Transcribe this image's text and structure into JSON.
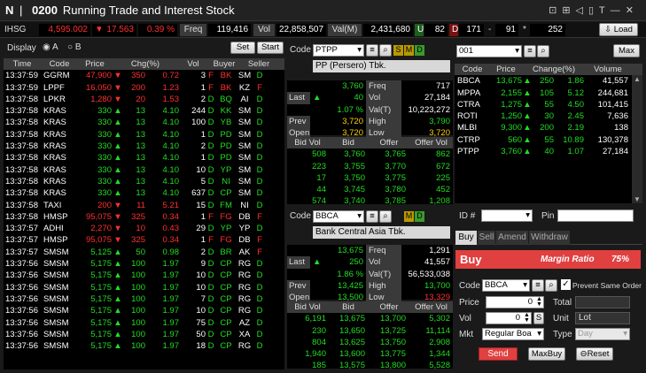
{
  "window": {
    "logo": "N",
    "title_code": "0200",
    "title": "Running Trade and Interest Stock",
    "icons": "⊡⊞◁▯T—✕"
  },
  "index": {
    "name": "IHSG",
    "value": "4,595.002",
    "change": "17.563",
    "pct": "0.39 %",
    "freq_lbl": "Freq",
    "freq": "119,416",
    "vol_lbl": "Vol",
    "vol": "22,858,507",
    "val_lbl": "Val(M)",
    "val": "2,431,680",
    "u_lbl": "U",
    "u": "82",
    "d_lbl": "D",
    "d": "171",
    "dash": "-",
    "n1": "91",
    "star": "*",
    "n2": "252",
    "load_label": "Load"
  },
  "display": {
    "label": "Display",
    "a": "A",
    "b": "B",
    "set": "Set",
    "start": "Start"
  },
  "trade": {
    "headers": [
      "Time",
      "Code",
      "Price",
      "Chg(%)",
      "Vol",
      "Buyer",
      "Seller"
    ],
    "rows": [
      [
        "13:37:59",
        "GGRM",
        "47,900",
        "▼",
        "350",
        "0.72",
        "3",
        "F",
        "BK",
        "SM",
        "D",
        "r"
      ],
      [
        "13:37:59",
        "LPPF",
        "16,050",
        "▼",
        "200",
        "1.23",
        "1",
        "F",
        "BK",
        "KZ",
        "F",
        "r"
      ],
      [
        "13:37:58",
        "LPKR",
        "1,280",
        "▼",
        "20",
        "1.53",
        "2",
        "D",
        "BQ",
        "AI",
        "D",
        "r"
      ],
      [
        "13:37:58",
        "KRAS",
        "330",
        "▲",
        "13",
        "4.10",
        "244",
        "D",
        "KK",
        "SM",
        "D",
        "g"
      ],
      [
        "13:37:58",
        "KRAS",
        "330",
        "▲",
        "13",
        "4.10",
        "100",
        "D",
        "YB",
        "SM",
        "D",
        "g"
      ],
      [
        "13:37:58",
        "KRAS",
        "330",
        "▲",
        "13",
        "4.10",
        "1",
        "D",
        "PD",
        "SM",
        "D",
        "g"
      ],
      [
        "13:37:58",
        "KRAS",
        "330",
        "▲",
        "13",
        "4.10",
        "2",
        "D",
        "PD",
        "SM",
        "D",
        "g"
      ],
      [
        "13:37:58",
        "KRAS",
        "330",
        "▲",
        "13",
        "4.10",
        "1",
        "D",
        "PD",
        "SM",
        "D",
        "g"
      ],
      [
        "13:37:58",
        "KRAS",
        "330",
        "▲",
        "13",
        "4.10",
        "10",
        "D",
        "YP",
        "SM",
        "D",
        "g"
      ],
      [
        "13:37:58",
        "KRAS",
        "330",
        "▲",
        "13",
        "4.10",
        "5",
        "D",
        "NI",
        "SM",
        "D",
        "g"
      ],
      [
        "13:37:58",
        "KRAS",
        "330",
        "▲",
        "13",
        "4.10",
        "637",
        "D",
        "CP",
        "SM",
        "D",
        "g"
      ],
      [
        "13:37:58",
        "TAXI",
        "200",
        "▼",
        "11",
        "5.21",
        "15",
        "D",
        "FM",
        "NI",
        "D",
        "r"
      ],
      [
        "13:37:58",
        "HMSP",
        "95,075",
        "▼",
        "325",
        "0.34",
        "1",
        "F",
        "FG",
        "DB",
        "F",
        "r"
      ],
      [
        "13:37:57",
        "ADHI",
        "2,270",
        "▼",
        "10",
        "0.43",
        "29",
        "D",
        "YP",
        "YP",
        "D",
        "r"
      ],
      [
        "13:37:57",
        "HMSP",
        "95,075",
        "▼",
        "325",
        "0.34",
        "1",
        "F",
        "FG",
        "DB",
        "F",
        "r"
      ],
      [
        "13:37:57",
        "SMSM",
        "5,125",
        "▲",
        "50",
        "0.98",
        "2",
        "D",
        "BR",
        "AK",
        "F",
        "g"
      ],
      [
        "13:37:56",
        "SMSM",
        "5,175",
        "▲",
        "100",
        "1.97",
        "9",
        "D",
        "CP",
        "RG",
        "D",
        "g"
      ],
      [
        "13:37:56",
        "SMSM",
        "5,175",
        "▲",
        "100",
        "1.97",
        "10",
        "D",
        "CP",
        "RG",
        "D",
        "g"
      ],
      [
        "13:37:56",
        "SMSM",
        "5,175",
        "▲",
        "100",
        "1.97",
        "10",
        "D",
        "CP",
        "RG",
        "D",
        "g"
      ],
      [
        "13:37:56",
        "SMSM",
        "5,175",
        "▲",
        "100",
        "1.97",
        "7",
        "D",
        "CP",
        "RG",
        "D",
        "g"
      ],
      [
        "13:37:56",
        "SMSM",
        "5,175",
        "▲",
        "100",
        "1.97",
        "10",
        "D",
        "CP",
        "RG",
        "D",
        "g"
      ],
      [
        "13:37:56",
        "SMSM",
        "5,175",
        "▲",
        "100",
        "1.97",
        "75",
        "D",
        "CP",
        "AZ",
        "D",
        "g"
      ],
      [
        "13:37:56",
        "SMSM",
        "5,175",
        "▲",
        "100",
        "1.97",
        "50",
        "D",
        "CP",
        "XA",
        "D",
        "g"
      ],
      [
        "13:37:56",
        "SMSM",
        "5,175",
        "▲",
        "100",
        "1.97",
        "18",
        "D",
        "CP",
        "RG",
        "D",
        "g"
      ]
    ]
  },
  "q1": {
    "code_lbl": "Code",
    "code": "PTPP",
    "s": "S",
    "m": "M",
    "d": "D",
    "name": "PP (Persero) Tbk.",
    "last_lbl": "Last",
    "last": "3,760",
    "chg": "40",
    "pct": "1.07 %",
    "prev_lbl": "Prev",
    "prev": "3,720",
    "open_lbl": "Open",
    "open": "3,720",
    "freq_lbl": "Freq",
    "freq": "717",
    "vol_lbl": "Vol",
    "vol": "27,184",
    "valt_lbl": "Val(T)",
    "valt": "10,223,272",
    "high_lbl": "High",
    "high": "3,790",
    "low_lbl": "Low",
    "low": "3,720",
    "book_headers": [
      "Bid Vol",
      "Bid",
      "Offer",
      "Offer Vol"
    ],
    "book": [
      [
        "508",
        "3,760",
        "3,765",
        "862"
      ],
      [
        "223",
        "3,755",
        "3,770",
        "672"
      ],
      [
        "17",
        "3,750",
        "3,775",
        "225"
      ],
      [
        "44",
        "3,745",
        "3,780",
        "452"
      ],
      [
        "574",
        "3,740",
        "3,785",
        "1,208"
      ]
    ]
  },
  "q2": {
    "code_lbl": "Code",
    "code": "BBCA",
    "m": "M",
    "d": "D",
    "name": "Bank Central Asia Tbk.",
    "last_lbl": "Last",
    "last": "13,675",
    "chg": "250",
    "pct": "1.86 %",
    "prev_lbl": "Prev",
    "prev": "13,425",
    "open_lbl": "Open",
    "open": "13,500",
    "freq_lbl": "Freq",
    "freq": "1,291",
    "vol_lbl": "Vol",
    "vol": "41,557",
    "valt_lbl": "Val(T)",
    "valt": "56,533,038",
    "high_lbl": "High",
    "high": "13,700",
    "low_lbl": "Low",
    "low": "13,329",
    "book_headers": [
      "Bid Vol",
      "Bid",
      "Offer",
      "Offer Vol"
    ],
    "book": [
      [
        "6,191",
        "13,675",
        "13,700",
        "5,302"
      ],
      [
        "230",
        "13,650",
        "13,725",
        "11,114"
      ],
      [
        "804",
        "13,625",
        "13,750",
        "2,908"
      ],
      [
        "1,940",
        "13,600",
        "13,775",
        "1,344"
      ],
      [
        "185",
        "13,575",
        "13,800",
        "5,528"
      ]
    ]
  },
  "watch": {
    "input": "001",
    "max": "Max",
    "headers": [
      "Code",
      "Price",
      "Change(%)",
      "Volume"
    ],
    "rows": [
      [
        "BBCA",
        "13,675",
        "250",
        "1.86",
        "41,557"
      ],
      [
        "MPPA",
        "2,155",
        "105",
        "5.12",
        "244,681"
      ],
      [
        "CTRA",
        "1,275",
        "55",
        "4.50",
        "101,415"
      ],
      [
        "ROTI",
        "1,250",
        "30",
        "2.45",
        "7,636"
      ],
      [
        "MLBI",
        "9,300",
        "200",
        "2.19",
        "138"
      ],
      [
        "CTRP",
        "560",
        "55",
        "10.89",
        "130,378"
      ],
      [
        "PTPP",
        "3,760",
        "40",
        "1.07",
        "27,184"
      ]
    ]
  },
  "order": {
    "id_lbl": "ID #",
    "pin_lbl": "Pin",
    "tabs": [
      "Buy",
      "Sell",
      "Amend",
      "Withdraw"
    ],
    "header": "Buy",
    "margin": "Margin Ratio",
    "margin_val": "75%",
    "code_lbl": "Code",
    "code": "BBCA",
    "prevent": "Prevent Same Order",
    "price_lbl": "Price",
    "price": "0",
    "total_lbl": "Total",
    "vol_lbl": "Vol",
    "vol": "0",
    "s": "S",
    "unit_lbl": "Unit",
    "unit": "Lot",
    "mkt_lbl": "Mkt",
    "mkt": "Regular Boa",
    "type_lbl": "Type",
    "type": "Day",
    "send": "Send",
    "maxbuy": "MaxBuy",
    "reset": "Reset"
  },
  "colors": {
    "up": "#22dd22",
    "down": "#ff3030",
    "unch": "#ffd000",
    "foreign": "#ff3030",
    "domestic": "#22dd22",
    "buy_header": "#e04040"
  }
}
